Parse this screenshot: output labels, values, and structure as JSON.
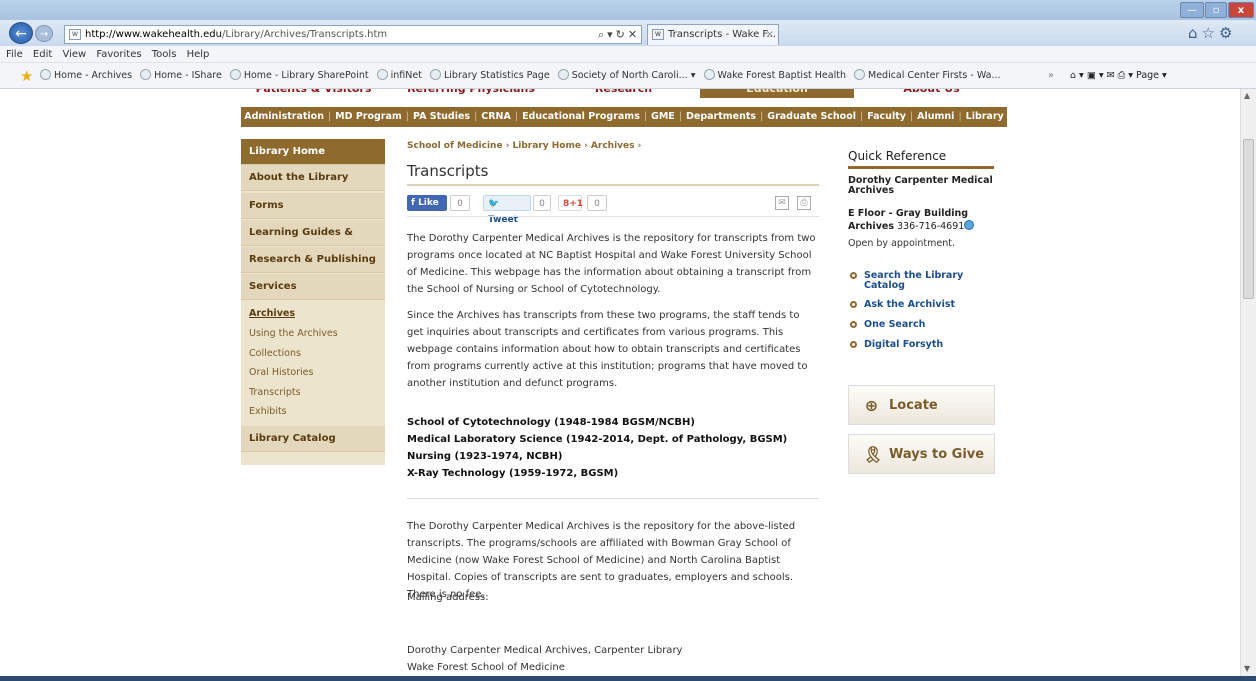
{
  "browser": {
    "url_host": "http://www.wakehealth.edu",
    "url_path": "/Library/Archives/Transcripts.htm",
    "tab_title": "Transcripts - Wake F...",
    "menu": [
      "File",
      "Edit",
      "View",
      "Favorites",
      "Tools",
      "Help"
    ],
    "favorites": [
      "Home - Archives",
      "Home - IShare",
      "Home - Library SharePoint",
      "infiNet",
      "Library Statistics Page",
      "Society of North Caroli... ▾",
      "Wake Forest Baptist Health",
      "Medical Center Firsts - Wa..."
    ],
    "command_bar": "Page ▾"
  },
  "site": {
    "top_nav": [
      "Patients & Visitors",
      "Referring Physicians",
      "Research",
      "Education",
      "About Us"
    ],
    "sub_nav": [
      "Administration",
      "MD Program",
      "PA Studies",
      "CRNA",
      "Educational Programs",
      "GME",
      "Departments",
      "Graduate School",
      "Faculty",
      "Alumni",
      "Library"
    ]
  },
  "sidebar": {
    "home": "Library Home",
    "sections": [
      "About the Library",
      "Forms",
      "Learning Guides & Tools",
      "Research & Publishing",
      "Services"
    ],
    "archives": "Archives",
    "archives_sub": [
      "Using the Archives",
      "Collections",
      "Oral Histories",
      "Transcripts",
      "Exhibits"
    ],
    "catalog": "Library Catalog"
  },
  "main": {
    "breadcrumb": "School of Medicine › Library Home › Archives ›",
    "title": "Transcripts",
    "social": {
      "like": "Like",
      "like_count": "0",
      "tweet": "Tweet",
      "tweet_count": "0",
      "gplus": "+1",
      "gplus_count": "0"
    },
    "p1": "The Dorothy Carpenter Medical Archives is the repository for transcripts from two programs once located at NC Baptist Hospital and Wake Forest University School of Medicine. This webpage has the information about obtaining a transcript from the School of Nursing or School of Cytotechnology.",
    "p2": "Since the Archives has transcripts from these two programs, the staff tends to get inquiries about transcripts and certificates from various programs. This webpage contains information about how to obtain transcripts and certificates from programs currently active at this institution; programs that have moved to another institution and defunct programs.",
    "programs": [
      "School of Cytotechnology (1948-1984 BGSM/NCBH)",
      "Medical Laboratory Science (1942-2014, Dept. of Pathology, BGSM)",
      "Nursing (1923-1974, NCBH)",
      "X-Ray Technology (1959-1972, BGSM)"
    ],
    "p3": "The Dorothy Carpenter Medical Archives is the repository for the above-listed transcripts. The programs/schools are affiliated with Bowman Gray School of Medicine (now Wake Forest School of Medicine) and North Carolina Baptist Hospital.  Copies of transcripts are sent to graduates, employers and schools. There is no fee.",
    "mailing": "Mailing address:",
    "addr1": "Dorothy Carpenter Medical Archives, Carpenter Library",
    "addr2": "Wake Forest School of Medicine"
  },
  "quick_ref": {
    "title": "Quick Reference",
    "org": "Dorothy Carpenter Medical Archives",
    "floor": "E Floor - Gray Building",
    "archives_label": "Archives",
    "phone": "336-716-4691",
    "open": "Open by appointment.",
    "links": [
      "Search the Library Catalog",
      "Ask the Archivist",
      "One Search",
      "Digital Forsyth"
    ],
    "cta_faculty": "Locate Faculty",
    "cta_give": "Ways to Give"
  }
}
